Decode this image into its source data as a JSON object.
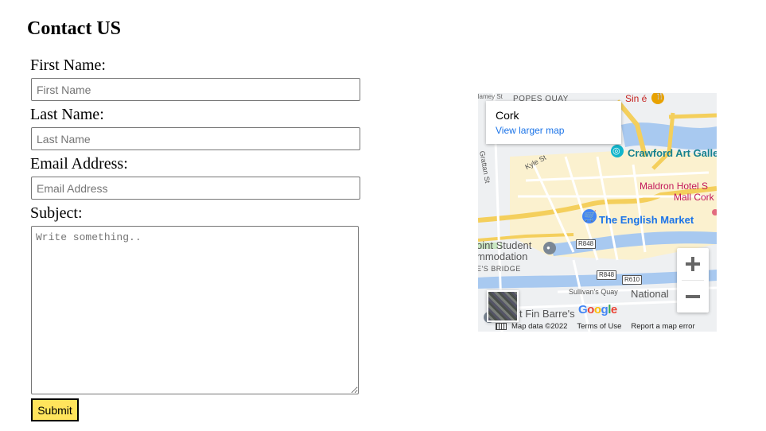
{
  "page": {
    "title": "Contact US"
  },
  "form": {
    "first_name": {
      "label": "First Name:",
      "placeholder": "First Name",
      "value": ""
    },
    "last_name": {
      "label": "Last Name:",
      "placeholder": "Last Name",
      "value": ""
    },
    "email": {
      "label": "Email Address:",
      "placeholder": "Email Address",
      "value": ""
    },
    "subject": {
      "label": "Subject:",
      "placeholder": "Write something..",
      "value": ""
    },
    "submit_label": "Submit",
    "submit_color": "#ffe45c"
  },
  "map": {
    "place_name": "Cork",
    "larger_map_link": "View larger map",
    "labels": {
      "popes_quay": "POPES QUAY",
      "sin_e": "Sin é",
      "crawford": "Crawford Art Galle",
      "kyle_st": "Kyle St",
      "grattan_st": "Grattan St",
      "maldron_1": "Maldron Hotel S",
      "maldron_2": "Mall Cork",
      "english_market": "The English Market",
      "student_1": "oint Student",
      "student_2": "mmodation",
      "bridge": "E'S BRIDGE",
      "r848_a": "R848",
      "r848_b": "R848",
      "r610": "R610",
      "sullivans_quay": "Sullivan's Quay",
      "national": "National",
      "fin_barres": "t Fin Barre's",
      "road_left": "llamey St"
    },
    "footer": {
      "map_data": "Map data ©2022",
      "terms": "Terms of Use",
      "report": "Report a map error"
    },
    "google_logo": [
      "G",
      "o",
      "o",
      "g",
      "l",
      "e"
    ],
    "icons": {
      "zoom_in": "plus-icon",
      "zoom_out": "minus-icon",
      "keyboard": "keyboard-icon",
      "place_pin": "map-pin-icon",
      "museum": "museum-icon",
      "shopping": "shopping-cart-icon"
    }
  }
}
